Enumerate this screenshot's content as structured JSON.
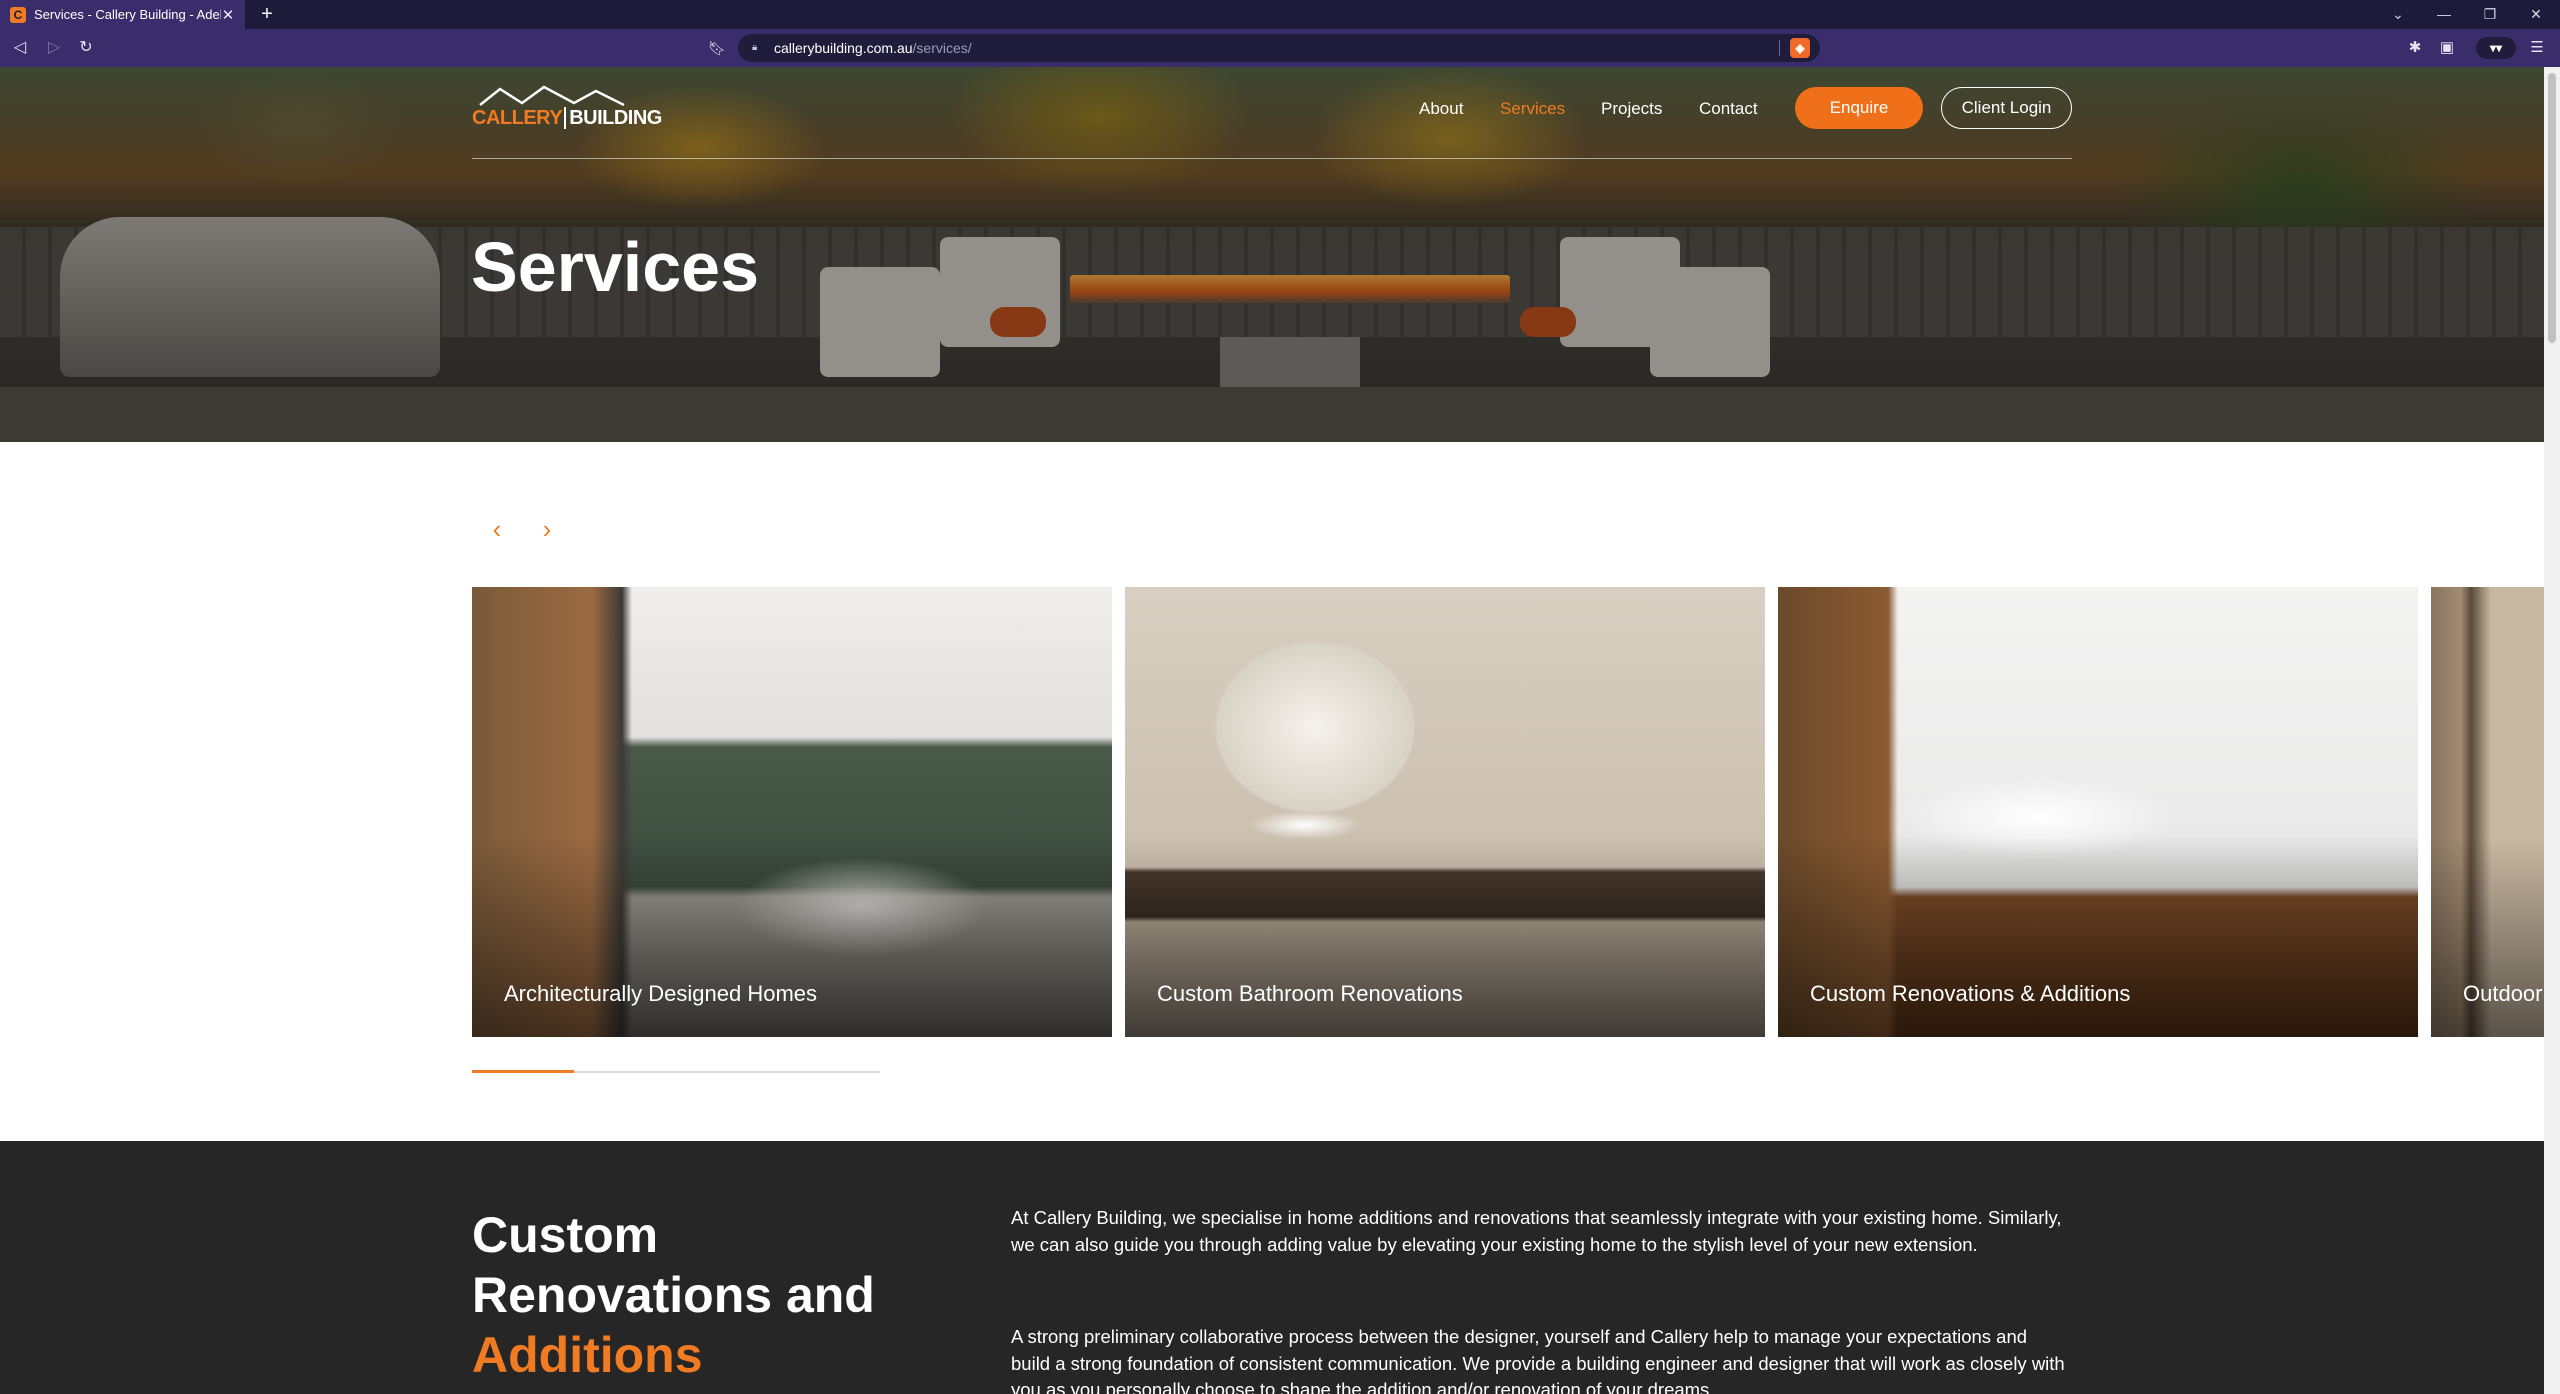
{
  "browser": {
    "tab_title": "Services - Callery Building - Adelaide",
    "tab_favicon": "C",
    "url_host": "callerybuilding.com.au",
    "url_path": "/services/",
    "profile_label": "▾▾"
  },
  "site": {
    "logo": {
      "part1": "CALLERY",
      "part2": "BUILDING"
    },
    "nav": [
      {
        "label": "About",
        "active": false
      },
      {
        "label": "Services",
        "active": true
      },
      {
        "label": "Projects",
        "active": false
      },
      {
        "label": "Contact",
        "active": false
      }
    ],
    "enquire_label": "Enquire",
    "login_label": "Client Login",
    "page_title": "Services",
    "accent_color": "#f07b22"
  },
  "slider": {
    "prev_icon": "chevron-left-icon",
    "next_icon": "chevron-right-icon",
    "cards": [
      {
        "label": "Architecturally Designed Homes"
      },
      {
        "label": "Custom Bathroom Renovations"
      },
      {
        "label": "Custom Renovations & Additions"
      },
      {
        "label": "Outdoor"
      }
    ],
    "progress": 0.25
  },
  "section": {
    "heading_plain": "Custom Renovations and ",
    "heading_accent": "Additions",
    "paragraphs": [
      "At Callery Building, we specialise in home additions and renovations that seamlessly integrate with your existing home. Similarly, we can also guide you through adding value by elevating your existing home to the stylish level of your new extension.",
      "A strong preliminary collaborative process between the designer, yourself and Callery help to manage your expectations and build a strong foundation of consistent communication. We provide a building engineer and designer that will work as closely with you as you personally choose to shape the addition and/or renovation of your dreams."
    ]
  }
}
